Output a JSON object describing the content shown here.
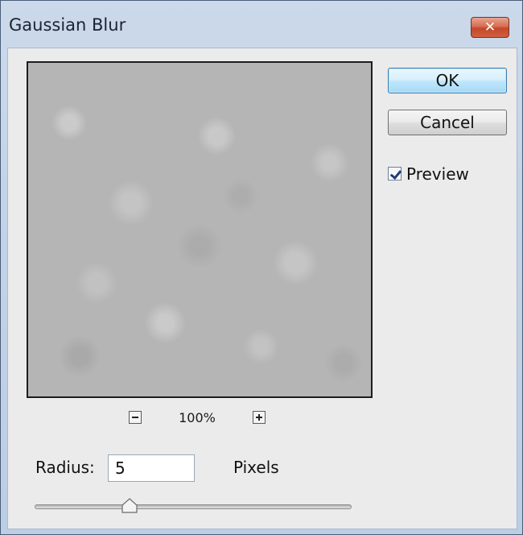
{
  "window": {
    "title": "Gaussian Blur",
    "close_symbol": "✕"
  },
  "preview": {
    "zoom_level": "100%"
  },
  "buttons": {
    "ok_label": "OK",
    "cancel_label": "Cancel"
  },
  "preview_toggle": {
    "label": "Preview",
    "checked": true
  },
  "radius": {
    "label": "Radius:",
    "value": "5",
    "unit_label": "Pixels",
    "slider_fraction": 0.3
  },
  "icons": {
    "zoom_out": "minus-icon",
    "zoom_in": "plus-icon",
    "close": "close-icon",
    "check": "checkmark-icon",
    "slider": "triangle-thumb-icon"
  },
  "colors": {
    "close_button": "#d0603f",
    "default_button_border": "#3c7fb1",
    "dialog_background": "#ebebeb"
  }
}
